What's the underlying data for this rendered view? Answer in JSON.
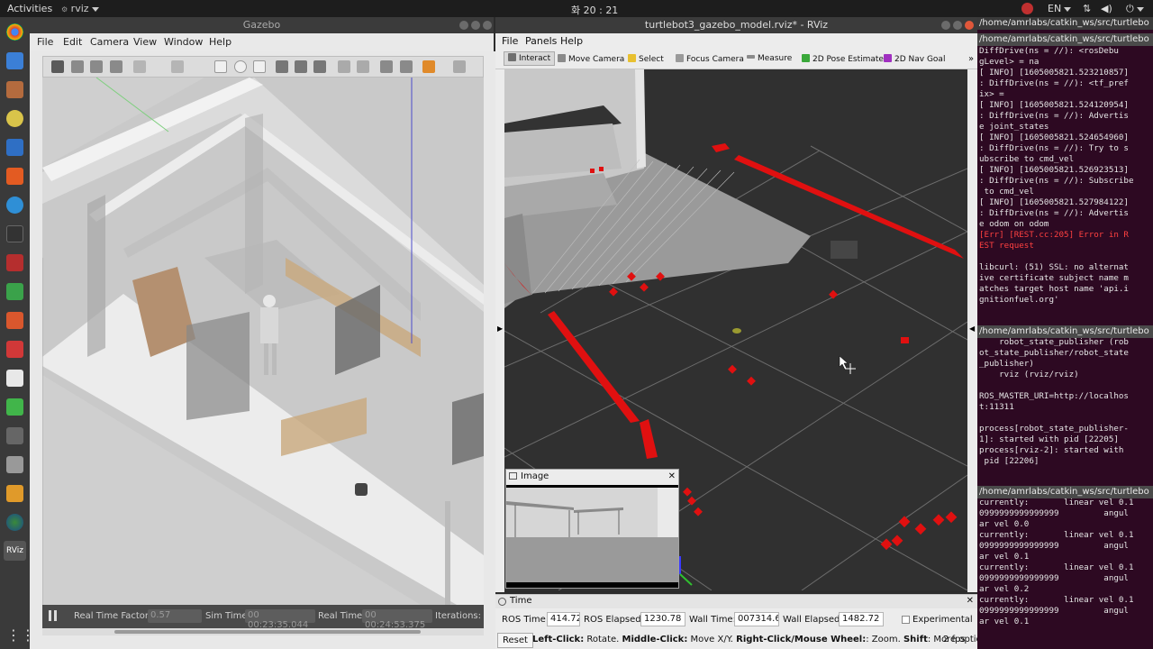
{
  "topbar": {
    "activities": "Activities",
    "app": "rviz",
    "clock": "화 20 : 21",
    "lang": "EN"
  },
  "dock": {
    "icons": [
      "chrome-icon",
      "thunderbird-icon",
      "files-icon",
      "rhythmbox-icon",
      "writer-icon",
      "software-center-icon",
      "help-icon",
      "terminal-icon",
      "screenshot-icon",
      "calc-icon",
      "impress-icon",
      "app-icon",
      "editor-icon",
      "qtcreator-icon",
      "inkscape-icon",
      "camera-icon",
      "layers-icon",
      "globe-icon",
      "rviz-icon",
      "app-grid-icon"
    ]
  },
  "gazebo": {
    "title": "Gazebo",
    "menu": [
      "File",
      "Edit",
      "Camera",
      "View",
      "Window",
      "Help"
    ],
    "status": {
      "rtf_label": "Real Time Factor:",
      "rtf": "0.57",
      "sim_label": "Sim Time:",
      "sim": "00 00:23:35.044",
      "real_label": "Real Time:",
      "real": "00 00:24:53.375",
      "iter_label": "Iterations:"
    }
  },
  "rviz": {
    "title": "turtlebot3_gazebo_model.rviz* - RViz",
    "menu": [
      "File",
      "Panels",
      "Help"
    ],
    "tools": [
      "Interact",
      "Move Camera",
      "Select",
      "Focus Camera",
      "Measure",
      "2D Pose Estimate",
      "2D Nav Goal"
    ],
    "tool_colors": [
      "#6f6f6f",
      "#8a8a8a",
      "#e8c030",
      "#9a9a9a",
      "#8a8a8a",
      "#3aa83a",
      "#a030c0"
    ],
    "image_panel": {
      "title": "Image"
    },
    "time_panel": {
      "title": "Time",
      "ros_time_label": "ROS Time:",
      "ros_time": "414.72",
      "ros_elapsed_label": "ROS Elapsed:",
      "ros_elapsed": "1230.78",
      "wall_time_label": "Wall Time:",
      "wall_time": "007314.64",
      "wall_elapsed_label": "Wall Elapsed:",
      "wall_elapsed": "1482.72",
      "experimental": "Experimental"
    },
    "help": {
      "reset": "Reset",
      "b1": "Left-Click:",
      "t1": " Rotate. ",
      "b2": "Middle-Click:",
      "t2": " Move X/Y. ",
      "b3": "Right-Click/Mouse Wheel:",
      "t3": ": Zoom. ",
      "b4": "Shift",
      "t4": ": More options",
      "fps": "2 fps"
    }
  },
  "terminals": {
    "title": "/home/amrlabs/catkin_ws/src/turtlebo",
    "pane1": [
      "DiffDrive(ns = //): <rosDebu",
      "gLevel> = na",
      "[ INFO] [1605005821.523210857]",
      ": DiffDrive(ns = //): <tf_pref",
      "ix> =",
      "[ INFO] [1605005821.524120954]",
      ": DiffDrive(ns = //): Advertis",
      "e joint_states",
      "[ INFO] [1605005821.524654960]",
      ": DiffDrive(ns = //): Try to s",
      "ubscribe to cmd_vel",
      "[ INFO] [1605005821.526923513]",
      ": DiffDrive(ns = //): Subscribe",
      " to cmd_vel",
      "[ INFO] [1605005821.527984122]",
      ": DiffDrive(ns = //): Advertis",
      "e odom on odom"
    ],
    "pane1_err": [
      "[Err] [REST.cc:205] Error in R",
      "EST request"
    ],
    "pane1_tail": [
      "",
      "libcurl: (51) SSL: no alternat",
      "ive certificate subject name m",
      "atches target host name 'api.i",
      "gnitionfuel.org'",
      ""
    ],
    "pane2": [
      "    robot_state_publisher (rob",
      "ot_state_publisher/robot_state",
      "_publisher)",
      "    rviz (rviz/rviz)",
      "",
      "ROS_MASTER_URI=http://localhos",
      "t:11311",
      "",
      "process[robot_state_publisher-",
      "1]: started with pid [22205]",
      "process[rviz-2]: started with",
      " pid [22206]",
      ""
    ],
    "pane3": [
      "currently:       linear vel 0.1",
      "0999999999999999         angul",
      "ar vel 0.0",
      "currently:       linear vel 0.1",
      "0999999999999999         angul",
      "ar vel 0.1",
      "currently:       linear vel 0.1",
      "0999999999999999         angul",
      "ar vel 0.2",
      "currently:       linear vel 0.1",
      "0999999999999999         angul",
      "ar vel 0.1"
    ]
  }
}
